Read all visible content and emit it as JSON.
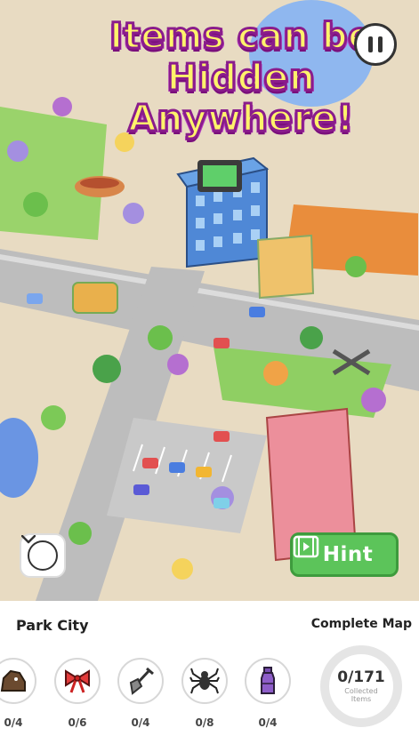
{
  "headline": {
    "line1": "Items can be",
    "line2": "Hidden Anywhere!"
  },
  "controls": {
    "pause_icon": "pause-icon",
    "expand_icon": "chevron-down-icon",
    "hint_icon": "video-icon",
    "hint_label": "Hint"
  },
  "map": {
    "name": "Park City"
  },
  "complete_map_label": "Complete Map",
  "items": [
    {
      "icon": "rock-icon",
      "count": "0/4"
    },
    {
      "icon": "bow-icon",
      "count": "0/6"
    },
    {
      "icon": "shovel-icon",
      "count": "0/4"
    },
    {
      "icon": "spider-icon",
      "count": "0/8"
    },
    {
      "icon": "bottle-icon",
      "count": "0/4"
    }
  ],
  "progress": {
    "count": "0/171",
    "label": "Collected Items",
    "fraction": 0
  },
  "colors": {
    "hint_green": "#5cc45a",
    "headline_yellow": "#fff36b",
    "headline_outline": "#8a1c8c"
  }
}
